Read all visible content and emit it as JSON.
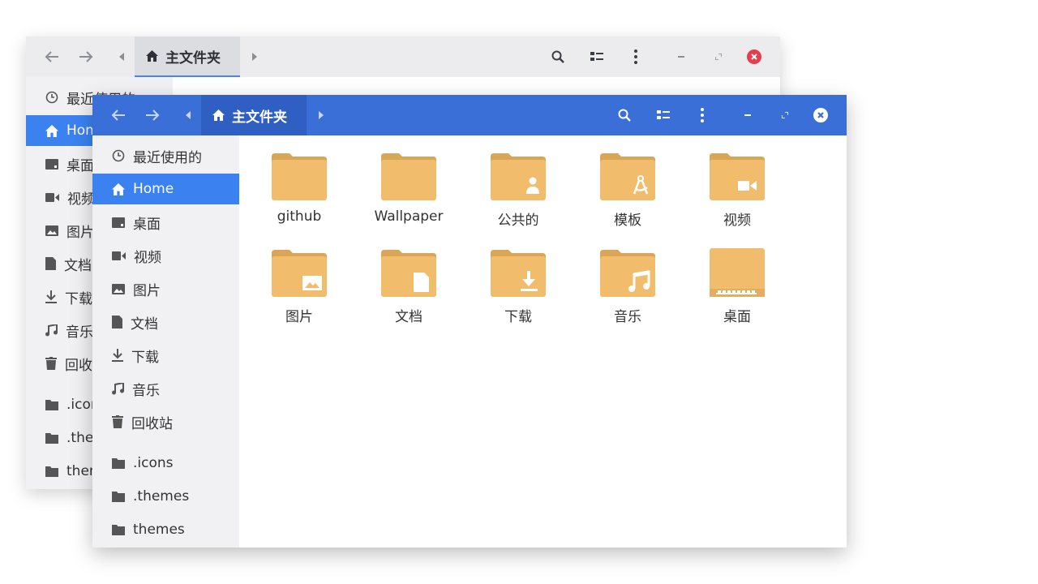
{
  "window": {
    "breadcrumb": "主文件夹"
  },
  "sidebar": [
    {
      "icon": "clock-icon",
      "label": "最近使用的"
    },
    {
      "icon": "home-icon",
      "label": "Home",
      "active": true
    },
    {
      "icon": "desktop-icon",
      "label": "桌面"
    },
    {
      "icon": "video-icon",
      "label": "视频"
    },
    {
      "icon": "picture-icon",
      "label": "图片"
    },
    {
      "icon": "document-icon",
      "label": "文档"
    },
    {
      "icon": "download-icon",
      "label": "下载"
    },
    {
      "icon": "music-icon",
      "label": "音乐"
    },
    {
      "icon": "trash-icon",
      "label": "回收站"
    },
    {
      "icon": "folder-icon",
      "label": ".icons"
    },
    {
      "icon": "folder-icon",
      "label": ".themes"
    },
    {
      "icon": "folder-icon",
      "label": "themes"
    }
  ],
  "files": [
    {
      "label": "github",
      "emblem": "none"
    },
    {
      "label": "Wallpaper",
      "emblem": "none"
    },
    {
      "label": "公共的",
      "emblem": "person"
    },
    {
      "label": "模板",
      "emblem": "compass"
    },
    {
      "label": "视频",
      "emblem": "video"
    },
    {
      "label": "图片",
      "emblem": "picture"
    },
    {
      "label": "文档",
      "emblem": "document"
    },
    {
      "label": "下载",
      "emblem": "download"
    },
    {
      "label": "音乐",
      "emblem": "music"
    },
    {
      "label": "桌面",
      "emblem": "desktop"
    }
  ],
  "colors": {
    "accent": "#3b82f0",
    "headerbar": "#3b6fd8",
    "folder": "#f2bc6d",
    "close": "#e53e4d"
  }
}
